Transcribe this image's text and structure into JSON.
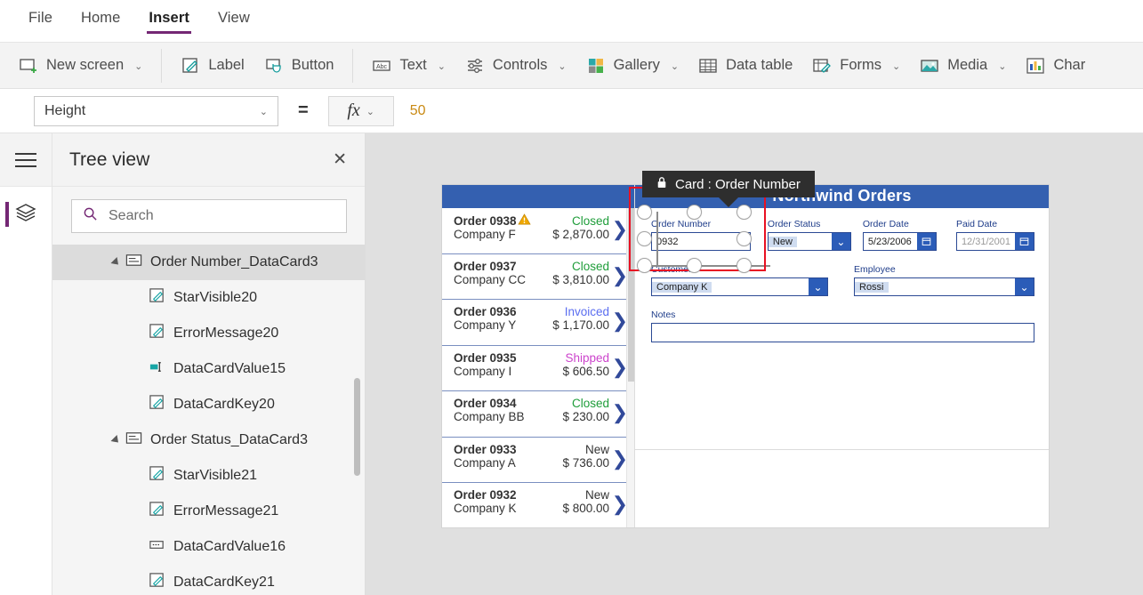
{
  "menubar": {
    "items": [
      {
        "label": "File",
        "active": false
      },
      {
        "label": "Home",
        "active": false
      },
      {
        "label": "Insert",
        "active": true
      },
      {
        "label": "View",
        "active": false
      }
    ]
  },
  "ribbon": {
    "items": [
      {
        "label": "New screen",
        "icon": "new-screen-icon",
        "has_chevron": true
      },
      {
        "label": "Label",
        "icon": "label-icon",
        "has_chevron": false
      },
      {
        "label": "Button",
        "icon": "button-icon",
        "has_chevron": false
      },
      {
        "label": "Text",
        "icon": "text-icon",
        "has_chevron": true
      },
      {
        "label": "Controls",
        "icon": "controls-icon",
        "has_chevron": true
      },
      {
        "label": "Gallery",
        "icon": "gallery-icon",
        "has_chevron": true
      },
      {
        "label": "Data table",
        "icon": "data-table-icon",
        "has_chevron": false
      },
      {
        "label": "Forms",
        "icon": "forms-icon",
        "has_chevron": true
      },
      {
        "label": "Media",
        "icon": "media-icon",
        "has_chevron": true
      },
      {
        "label": "Char",
        "icon": "charts-icon",
        "has_chevron": false
      }
    ],
    "chevron": "⌄"
  },
  "formula_bar": {
    "property": "Height",
    "property_chevron": "⌄",
    "equals": "=",
    "fx_symbol": "fx",
    "fx_chevron": "⌄",
    "value": "50"
  },
  "rail": {
    "hamburger_name": "hamburger-menu-icon",
    "buttons": [
      {
        "name": "tree-view-rail-button",
        "icon": "layers-icon",
        "active": true
      }
    ]
  },
  "treeview": {
    "title": "Tree view",
    "close_label": "✕",
    "search": {
      "placeholder": "Search",
      "value": "",
      "icon": "search-icon"
    },
    "items": [
      {
        "label": "Order Number_DataCard3",
        "level": 1,
        "icon": "datacard-icon",
        "caret": true,
        "selected": true
      },
      {
        "label": "StarVisible20",
        "level": 2,
        "icon": "label-control-icon",
        "caret": false,
        "selected": false
      },
      {
        "label": "ErrorMessage20",
        "level": 2,
        "icon": "label-control-icon",
        "caret": false,
        "selected": false
      },
      {
        "label": "DataCardValue15",
        "level": 2,
        "icon": "textinput-control-icon",
        "caret": false,
        "selected": false
      },
      {
        "label": "DataCardKey20",
        "level": 2,
        "icon": "label-control-icon",
        "caret": false,
        "selected": false
      },
      {
        "label": "Order Status_DataCard3",
        "level": 1,
        "icon": "datacard-icon",
        "caret": true,
        "selected": false
      },
      {
        "label": "StarVisible21",
        "level": 2,
        "icon": "label-control-icon",
        "caret": false,
        "selected": false
      },
      {
        "label": "ErrorMessage21",
        "level": 2,
        "icon": "label-control-icon",
        "caret": false,
        "selected": false
      },
      {
        "label": "DataCardValue16",
        "level": 2,
        "icon": "dropdown-control-icon",
        "caret": false,
        "selected": false
      },
      {
        "label": "DataCardKey21",
        "level": 2,
        "icon": "label-control-icon",
        "caret": false,
        "selected": false
      }
    ]
  },
  "canvas": {
    "tooltip": {
      "text": "Card : Order Number",
      "icon": "lock-icon"
    },
    "app_title": "Northwind Orders",
    "gallery": {
      "rows": [
        {
          "order": "Order 0938",
          "company": "Company F",
          "status": "Closed",
          "status_color": "#1f9d3a",
          "amount": "$ 2,870.00",
          "warning": true
        },
        {
          "order": "Order 0937",
          "company": "Company CC",
          "status": "Closed",
          "status_color": "#1f9d3a",
          "amount": "$ 3,810.00",
          "warning": false
        },
        {
          "order": "Order 0936",
          "company": "Company Y",
          "status": "Invoiced",
          "status_color": "#5b6ef0",
          "amount": "$ 1,170.00",
          "warning": false
        },
        {
          "order": "Order 0935",
          "company": "Company I",
          "status": "Shipped",
          "status_color": "#cc44cc",
          "amount": "$ 606.50",
          "warning": false
        },
        {
          "order": "Order 0934",
          "company": "Company BB",
          "status": "Closed",
          "status_color": "#1f9d3a",
          "amount": "$ 230.00",
          "warning": false
        },
        {
          "order": "Order 0933",
          "company": "Company A",
          "status": "New",
          "status_color": "#333333",
          "amount": "$ 736.00",
          "warning": false
        },
        {
          "order": "Order 0932",
          "company": "Company K",
          "status": "New",
          "status_color": "#333333",
          "amount": "$ 800.00",
          "warning": false
        }
      ],
      "chevron": "❯"
    },
    "form": {
      "order_number": {
        "label": "Order Number",
        "value": "0932"
      },
      "order_status": {
        "label": "Order Status",
        "value": "New",
        "arrow": "⌄"
      },
      "order_date": {
        "label": "Order Date",
        "value": "5/23/2006",
        "icon": "calendar-icon"
      },
      "paid_date": {
        "label": "Paid Date",
        "value": "12/31/2001",
        "icon": "calendar-icon",
        "placeholder_style": true
      },
      "customer": {
        "label": "Customer",
        "value": "Company K",
        "arrow": "⌄"
      },
      "employee": {
        "label": "Employee",
        "value": "Rossi",
        "arrow": "⌄"
      },
      "notes": {
        "label": "Notes",
        "value": ""
      }
    }
  },
  "colors": {
    "accent_purple": "#742774",
    "app_blue": "#3460b0",
    "selection_red": "#e81123",
    "formula_value": "#c98a14"
  }
}
